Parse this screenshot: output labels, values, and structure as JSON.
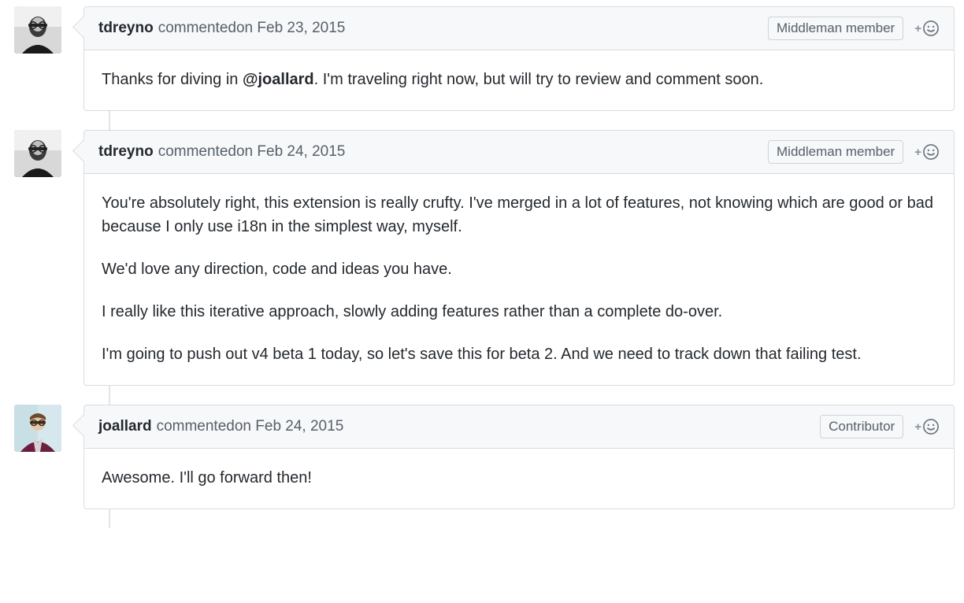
{
  "comments": [
    {
      "author": "tdreyno",
      "verb": "commented",
      "on": "on",
      "date": "Feb 23, 2015",
      "badge": "Middleman member",
      "avatar_variant": "bw",
      "body": [
        [
          {
            "t": "Thanks for diving in "
          },
          {
            "mention": "@joallard"
          },
          {
            "t": ". I'm traveling right now, but will try to review and comment soon."
          }
        ]
      ]
    },
    {
      "author": "tdreyno",
      "verb": "commented",
      "on": "on",
      "date": "Feb 24, 2015",
      "badge": "Middleman member",
      "avatar_variant": "bw",
      "body": [
        [
          {
            "t": "You're absolutely right, this extension is really crufty. I've merged in a lot of features, not knowing which are good or bad because I only use i18n in the simplest way, myself."
          }
        ],
        [
          {
            "t": "We'd love any direction, code and ideas you have."
          }
        ],
        [
          {
            "t": "I really like this iterative approach, slowly adding features rather than a complete do-over."
          }
        ],
        [
          {
            "t": "I'm going to push out v4 beta 1 today, so let's save this for beta 2. And we need to track down that failing test."
          }
        ]
      ]
    },
    {
      "author": "joallard",
      "verb": "commented",
      "on": "on",
      "date": "Feb 24, 2015",
      "badge": "Contributor",
      "avatar_variant": "color",
      "body": [
        [
          {
            "t": "Awesome. I'll go forward then!"
          }
        ]
      ]
    }
  ]
}
